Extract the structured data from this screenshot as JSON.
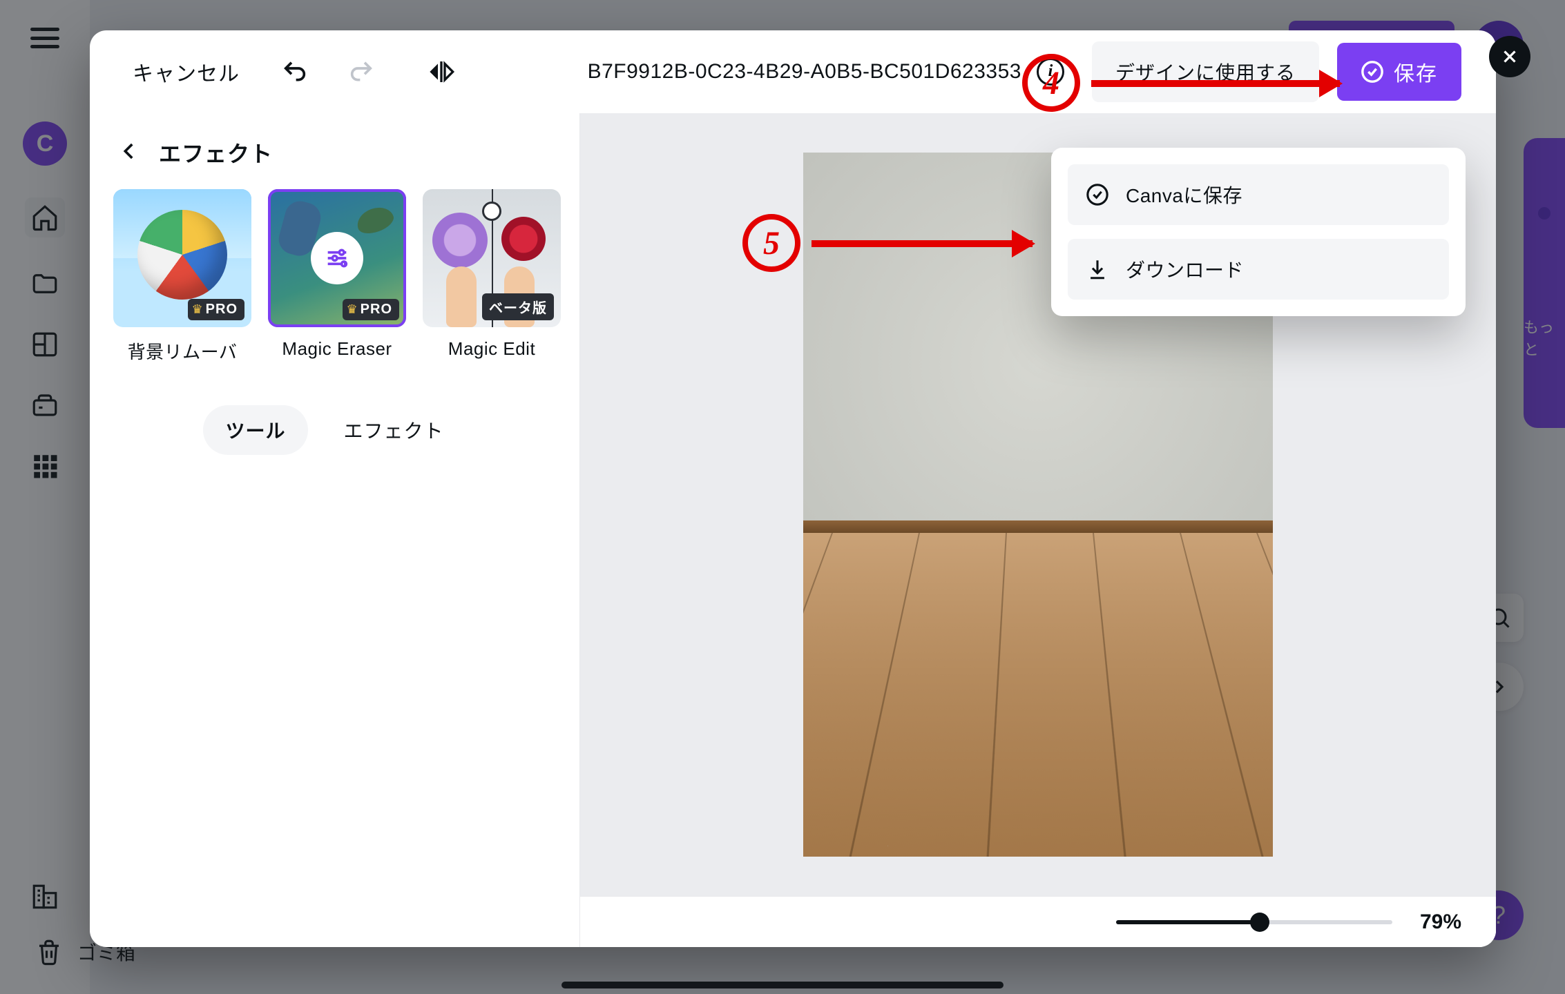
{
  "bg": {
    "avatar_letter": "C",
    "trash_label": "ゴミ箱",
    "right_more": "もっと"
  },
  "modal": {
    "cancel": "キャンセル",
    "doc_title": "B7F9912B-0C23-4B29-A0B5-BC501D623353",
    "use_in_design": "デザインに使用する",
    "save": "保存"
  },
  "left": {
    "title": "エフェクト",
    "effects": [
      {
        "label": "背景リムーバ",
        "badge": "PRO"
      },
      {
        "label": "Magic Eraser",
        "badge": "PRO"
      },
      {
        "label": "Magic Edit",
        "badge": "ベータ版"
      }
    ],
    "tabs": {
      "tools": "ツール",
      "effects": "エフェクト"
    }
  },
  "dropdown": {
    "save_to_canva": "Canvaに保存",
    "download": "ダウンロード"
  },
  "zoom": {
    "value": "79%",
    "percent": 52
  },
  "annotations": {
    "step4": "4",
    "step5": "5"
  }
}
